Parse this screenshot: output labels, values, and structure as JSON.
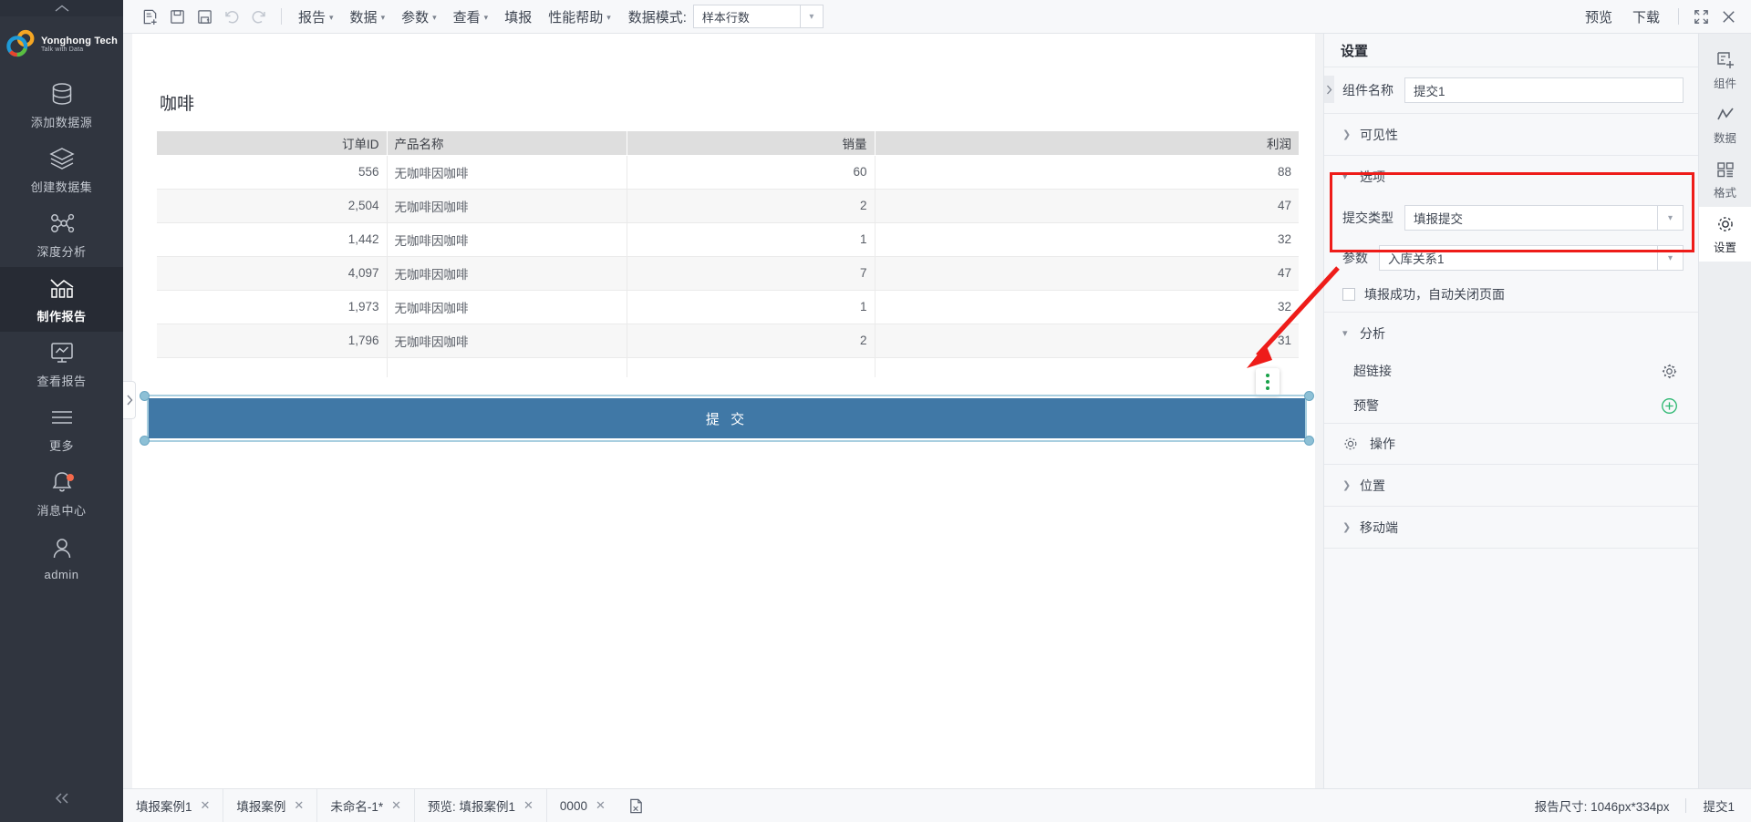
{
  "sidebar": {
    "collapse_top_icon": "chevron-up-icon",
    "logo": {
      "name": "Yonghong Tech",
      "tagline": "Talk with Data"
    },
    "items": [
      {
        "label": "添加数据源",
        "icon": "database-icon",
        "active": false,
        "badge": false
      },
      {
        "label": "创建数据集",
        "icon": "layers-icon",
        "active": false,
        "badge": false
      },
      {
        "label": "深度分析",
        "icon": "node-graph-icon",
        "active": false,
        "badge": false
      },
      {
        "label": "制作报告",
        "icon": "bar-chart-icon",
        "active": true,
        "badge": false
      },
      {
        "label": "查看报告",
        "icon": "monitor-chart-icon",
        "active": false,
        "badge": false
      },
      {
        "label": "更多",
        "icon": "menu-lines-icon",
        "active": false,
        "badge": false
      },
      {
        "label": "消息中心",
        "icon": "bell-icon",
        "active": false,
        "badge": true
      },
      {
        "label": "admin",
        "icon": "user-icon",
        "active": false,
        "badge": false
      }
    ],
    "collapse_bottom_icon": "chevron-double-left-icon"
  },
  "toolbar": {
    "icons": [
      {
        "name": "new-report-icon",
        "disabled": false
      },
      {
        "name": "save-icon",
        "disabled": false
      },
      {
        "name": "save-as-icon",
        "disabled": false
      },
      {
        "name": "undo-icon",
        "disabled": true
      },
      {
        "name": "redo-icon",
        "disabled": true
      }
    ],
    "menus": [
      {
        "label": "报告",
        "has_caret": true
      },
      {
        "label": "数据",
        "has_caret": true
      },
      {
        "label": "参数",
        "has_caret": true
      },
      {
        "label": "查看",
        "has_caret": true
      },
      {
        "label": "填报",
        "has_caret": false
      },
      {
        "label": "性能帮助",
        "has_caret": true
      }
    ],
    "data_mode_label": "数据模式:",
    "data_mode_value": "样本行数",
    "right_actions": [
      {
        "label": "预览"
      },
      {
        "label": "下载"
      }
    ],
    "fullscreen_icon": "expand-icon",
    "close_icon": "close-icon"
  },
  "canvas": {
    "toggle_icon": "chevron-right-icon",
    "report_title": "咖啡",
    "row_menu_icon": "more-vertical-icon",
    "submit_button_label": "提 交"
  },
  "table_data": {
    "type": "table",
    "columns": [
      {
        "key": "order_id",
        "label": "订单ID",
        "align": "right"
      },
      {
        "key": "product",
        "label": "产品名称",
        "align": "left"
      },
      {
        "key": "sales",
        "label": "销量",
        "align": "right"
      },
      {
        "key": "profit",
        "label": "利润",
        "align": "right"
      }
    ],
    "rows": [
      {
        "order_id": "556",
        "product": "无咖啡因咖啡",
        "sales": "60",
        "profit": "88"
      },
      {
        "order_id": "2,504",
        "product": "无咖啡因咖啡",
        "sales": "2",
        "profit": "47"
      },
      {
        "order_id": "1,442",
        "product": "无咖啡因咖啡",
        "sales": "1",
        "profit": "32"
      },
      {
        "order_id": "4,097",
        "product": "无咖啡因咖啡",
        "sales": "7",
        "profit": "47"
      },
      {
        "order_id": "1,973",
        "product": "无咖啡因咖啡",
        "sales": "1",
        "profit": "32"
      },
      {
        "order_id": "1,796",
        "product": "无咖啡因咖啡",
        "sales": "2",
        "profit": "31"
      }
    ]
  },
  "settings_panel": {
    "collapse_icon": "chevron-right-icon",
    "title": "设置",
    "component_name_label": "组件名称",
    "component_name_value": "提交1",
    "visibility_section": {
      "label": "可见性",
      "expanded": false
    },
    "options_section": {
      "label": "选项",
      "expanded": true
    },
    "submit_type_label": "提交类型",
    "submit_type_value": "填报提交",
    "param_label": "参数",
    "param_value": "入库关系1",
    "auto_close_label": "填报成功，自动关闭页面",
    "auto_close_checked": false,
    "analysis_section": {
      "label": "分析",
      "expanded": true
    },
    "hyperlink_label": "超链接",
    "hyperlink_icon": "gear-icon",
    "alert_label": "预警",
    "alert_icon": "plus-circle-icon",
    "operation_label": "操作",
    "operation_icon": "gear-icon",
    "position_section": {
      "label": "位置",
      "expanded": false
    },
    "mobile_section": {
      "label": "移动端",
      "expanded": false
    },
    "highlight_color": "#ee1c19"
  },
  "rail": {
    "items": [
      {
        "label": "组件",
        "icon": "component-add-icon",
        "active": false
      },
      {
        "label": "数据",
        "icon": "data-line-icon",
        "active": false
      },
      {
        "label": "格式",
        "icon": "format-grid-icon",
        "active": false
      },
      {
        "label": "设置",
        "icon": "gear-icon",
        "active": true
      }
    ]
  },
  "tabbar": {
    "tabs": [
      {
        "label": "填报案例1",
        "closable": true
      },
      {
        "label": "填报案例",
        "closable": true
      },
      {
        "label": "未命名-1*",
        "closable": true
      },
      {
        "label": "预览: 填报案例1",
        "closable": true
      },
      {
        "label": "0000",
        "closable": true
      }
    ],
    "new_file_icon": "new-file-icon",
    "report_size_text": "报告尺寸: 1046px*334px",
    "selected_component": "提交1"
  },
  "colors": {
    "sidebar_bg": "#30353f",
    "sidebar_active": "#272b34",
    "toolbar_bg": "#f7f8fa",
    "submit_button": "#4078a6",
    "selection_handle": "#8dc0d6",
    "annotation_red": "#ee1c19",
    "accent_green": "#19a24a"
  }
}
